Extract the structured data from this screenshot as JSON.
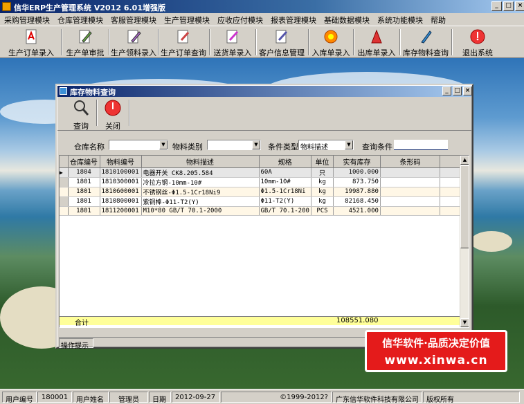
{
  "app": {
    "title": "信华ERP生产管理系统  V2012  6.01增强版"
  },
  "menu": [
    "采购管理模块",
    "仓库管理模块",
    "客服管理模块",
    "生产管理模块",
    "应收应付模块",
    "报表管理模块",
    "基础数据模块",
    "系统功能模块",
    "帮助"
  ],
  "toolbar": [
    {
      "label": "生产订单录入",
      "icon": "pdf-document-icon"
    },
    {
      "label": "生产单审批",
      "icon": "pencil-edit-icon"
    },
    {
      "label": "生产领料录入",
      "icon": "form-edit-icon"
    },
    {
      "label": "生产订单查询",
      "icon": "query-document-icon"
    },
    {
      "label": "送货单录入",
      "icon": "delivery-document-icon"
    },
    {
      "label": "客户信息管理",
      "icon": "customer-info-icon"
    },
    {
      "label": "入库单录入",
      "icon": "stock-in-icon"
    },
    {
      "label": "出库单录入",
      "icon": "stock-out-icon"
    },
    {
      "label": "库存物料查询",
      "icon": "inventory-query-icon"
    },
    {
      "label": "退出系统",
      "icon": "exit-power-icon"
    }
  ],
  "child": {
    "title": "库存物料查询",
    "buttons": {
      "query": "查询",
      "close": "关闭"
    },
    "filters": {
      "warehouse_label": "仓库名称",
      "warehouse_value": "",
      "category_label": "物料类别",
      "category_value": "",
      "condition_type_label": "条件类型",
      "condition_type_value": "物料描述",
      "query_condition_label": "查询条件",
      "query_condition_value": ""
    },
    "columns": [
      "仓库编号",
      "物料编号",
      "物料描述",
      "规格",
      "单位",
      "实有库存",
      "条形码"
    ],
    "rows": [
      {
        "wh": "1804",
        "code": "1810100001",
        "desc": "电器开关 CK8.205.584",
        "spec": "60A",
        "unit": "只",
        "qty": "1000.000",
        "barcode": ""
      },
      {
        "wh": "1801",
        "code": "1810300001",
        "desc": "冷拉方钢-10mm-10#",
        "spec": "10mm-10#",
        "unit": "kg",
        "qty": "873.750",
        "barcode": ""
      },
      {
        "wh": "1801",
        "code": "1810600001",
        "desc": "不锈钢丝-Φ1.5-1Cr18Ni9",
        "spec": "Φ1.5-1Cr18Ni",
        "unit": "kg",
        "qty": "19987.880",
        "barcode": ""
      },
      {
        "wh": "1801",
        "code": "1810800001",
        "desc": "紫铜棒-Φ11-T2(Y)",
        "spec": "Φ11-T2(Y)",
        "unit": "kg",
        "qty": "82168.450",
        "barcode": ""
      },
      {
        "wh": "1801",
        "code": "1811200001",
        "desc": "M10*80 GB/T 70.1-2000",
        "spec": "GB/T 70.1-200",
        "unit": "PCS",
        "qty": "4521.000",
        "barcode": ""
      }
    ],
    "total": {
      "label": "合计",
      "qty": "108551.080"
    },
    "op_hint": "操作提示"
  },
  "promo": {
    "line1": "信华软件·品质决定价值",
    "line2": "www.xinwa.cn"
  },
  "status": {
    "user_id_label": "用户编号",
    "user_id": "180001",
    "user_name_label": "用户姓名",
    "user_name": "管理员",
    "date_label": "日期",
    "date": "2012-09-27",
    "copyright": "©1999-2012?",
    "company": "广东信华软件科技有限公司",
    "rights": "版权所有"
  },
  "colors": {
    "title_dark": "#0a246a",
    "title_light": "#a6caf0",
    "total_row": "#ffff99",
    "promo_red": "#e41b1b"
  }
}
